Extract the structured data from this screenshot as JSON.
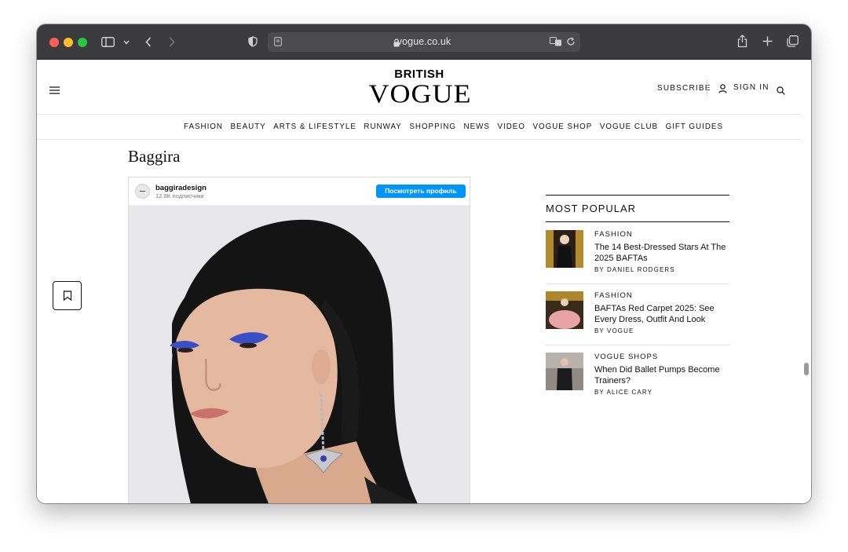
{
  "browser": {
    "url": "vogue.co.uk"
  },
  "site": {
    "logo_top": "BRITISH",
    "logo_main": "VOGUE",
    "subscribe_label": "SUBSCRIBE",
    "signin_label": "SIGN IN"
  },
  "nav": {
    "items": [
      "FASHION",
      "BEAUTY",
      "ARTS & LIFESTYLE",
      "RUNWAY",
      "SHOPPING",
      "NEWS",
      "VIDEO",
      "VOGUE SHOP",
      "VOGUE CLUB",
      "GIFT GUIDES"
    ]
  },
  "article": {
    "title": "Baggira"
  },
  "instagram": {
    "username": "baggiradesign",
    "followers": "12.9K подписчики",
    "view_profile": "Посмотреть профиль"
  },
  "most_popular": {
    "heading": "MOST POPULAR",
    "items": [
      {
        "category": "FASHION",
        "headline": "The 14 Best-Dressed Stars At The 2025 BAFTAs",
        "byline": "BY DANIEL RODGERS"
      },
      {
        "category": "FASHION",
        "headline": "BAFTAs Red Carpet 2025: See Every Dress, Outfit And Look",
        "byline": "BY VOGUE"
      },
      {
        "category": "VOGUE SHOPS",
        "headline": "When Did Ballet Pumps Become Trainers?",
        "byline": "BY ALICE CARY"
      }
    ]
  },
  "colors": {
    "instagram_button": "#0095f6",
    "toolbar": "#3b3b3d"
  },
  "icons": [
    "sidebar-icon",
    "chevron-down-icon",
    "back-icon",
    "forward-icon",
    "privacy-shield-icon",
    "reader-icon",
    "lock-icon",
    "translate-icon",
    "reload-icon",
    "share-icon",
    "new-tab-icon",
    "tabs-icon",
    "menu-icon",
    "user-icon",
    "search-icon",
    "bookmark-icon"
  ]
}
